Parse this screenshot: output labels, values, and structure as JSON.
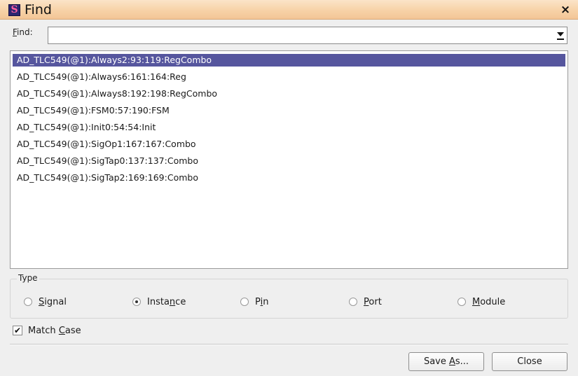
{
  "window": {
    "title": "Find",
    "app_icon_letter": "S",
    "close_glyph": "×"
  },
  "find": {
    "label_mnemonic": "F",
    "label_rest": "ind:",
    "value": "",
    "placeholder": ""
  },
  "results": {
    "items": [
      {
        "text": "AD_TLC549(@1):Always2:93:119:RegCombo",
        "selected": true
      },
      {
        "text": "AD_TLC549(@1):Always6:161:164:Reg",
        "selected": false
      },
      {
        "text": "AD_TLC549(@1):Always8:192:198:RegCombo",
        "selected": false
      },
      {
        "text": "AD_TLC549(@1):FSM0:57:190:FSM",
        "selected": false
      },
      {
        "text": "AD_TLC549(@1):Init0:54:54:Init",
        "selected": false
      },
      {
        "text": "AD_TLC549(@1):SigOp1:167:167:Combo",
        "selected": false
      },
      {
        "text": "AD_TLC549(@1):SigTap0:137:137:Combo",
        "selected": false
      },
      {
        "text": "AD_TLC549(@1):SigTap2:169:169:Combo",
        "selected": false
      }
    ],
    "selection_color": "#56569e"
  },
  "type_group": {
    "legend": "Type",
    "options": [
      {
        "pre": "",
        "mnemonic": "S",
        "post": "ignal",
        "checked": false
      },
      {
        "pre": "Insta",
        "mnemonic": "n",
        "post": "ce",
        "checked": true
      },
      {
        "pre": "P",
        "mnemonic": "i",
        "post": "n",
        "checked": false
      },
      {
        "pre": "",
        "mnemonic": "P",
        "post": "ort",
        "checked": false
      },
      {
        "pre": "",
        "mnemonic": "M",
        "post": "odule",
        "checked": false
      }
    ]
  },
  "match_case": {
    "pre": "Match ",
    "mnemonic": "C",
    "post": "ase",
    "checked": true,
    "check_glyph": "✔"
  },
  "buttons": {
    "save_as": {
      "pre": "Save ",
      "mnemonic": "A",
      "post": "s..."
    },
    "close": {
      "label": "Close"
    }
  },
  "colors": {
    "titlebar_accent": "#f7d2a7",
    "background": "#efefef"
  }
}
